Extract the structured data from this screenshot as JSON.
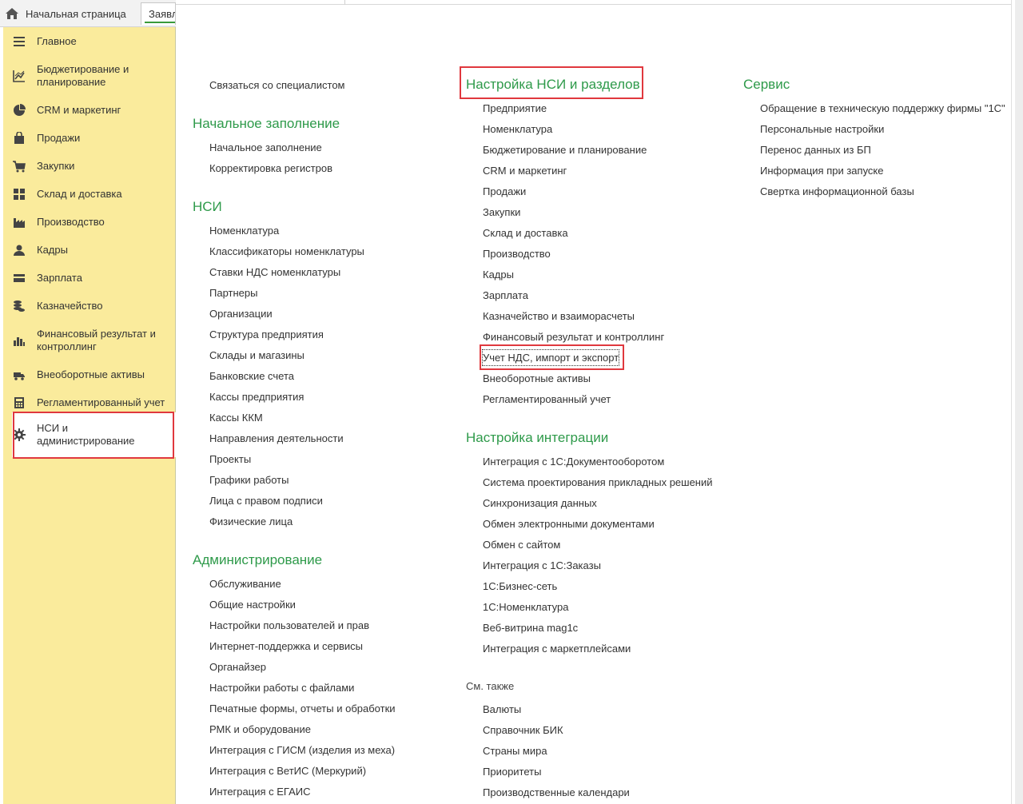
{
  "tabs": {
    "home_label": "Начальная страница",
    "second_label": "Заявления"
  },
  "sidebar": {
    "items": [
      {
        "label": "Главное",
        "icon": "menu-lines-icon"
      },
      {
        "label": "Бюджетирование и планирование",
        "icon": "budget-chart-icon"
      },
      {
        "label": "CRM и маркетинг",
        "icon": "pie-chart-icon"
      },
      {
        "label": "Продажи",
        "icon": "shopping-bag-icon"
      },
      {
        "label": "Закупки",
        "icon": "cart-icon"
      },
      {
        "label": "Склад и доставка",
        "icon": "warehouse-grid-icon"
      },
      {
        "label": "Производство",
        "icon": "factory-icon"
      },
      {
        "label": "Кадры",
        "icon": "person-icon"
      },
      {
        "label": "Зарплата",
        "icon": "wallet-icon"
      },
      {
        "label": "Казначейство",
        "icon": "coins-icon"
      },
      {
        "label": "Финансовый результат и контроллинг",
        "icon": "bar-chart-icon"
      },
      {
        "label": "Внеоборотные активы",
        "icon": "truck-icon"
      },
      {
        "label": "Регламентированный учет",
        "icon": "calculator-icon"
      },
      {
        "label": "НСИ и администрирование",
        "icon": "gear-icon",
        "active": true
      }
    ]
  },
  "col1": {
    "top_link": "Связаться со специалистом",
    "initial": {
      "title": "Начальное заполнение",
      "links": [
        "Начальное заполнение",
        "Корректировка регистров"
      ]
    },
    "nsi": {
      "title": "НСИ",
      "links": [
        "Номенклатура",
        "Классификаторы номенклатуры",
        "Ставки НДС номенклатуры",
        "Партнеры",
        "Организации",
        "Структура предприятия",
        "Склады и магазины",
        "Банковские счета",
        "Кассы предприятия",
        "Кассы ККМ",
        "Направления деятельности",
        "Проекты",
        "Графики работы",
        "Лица с правом подписи",
        "Физические лица"
      ]
    },
    "admin": {
      "title": "Администрирование",
      "links": [
        "Обслуживание",
        "Общие настройки",
        "Настройки пользователей и прав",
        "Интернет-поддержка и сервисы",
        "Органайзер",
        "Настройки работы с файлами",
        "Печатные формы, отчеты и обработки",
        "РМК и оборудование",
        "Интеграция с ГИСМ (изделия из меха)",
        "Интеграция с ВетИС (Меркурий)",
        "Интеграция с ЕГАИС"
      ]
    }
  },
  "col2": {
    "settings": {
      "title": "Настройка НСИ и разделов",
      "links": [
        "Предприятие",
        "Номенклатура",
        "Бюджетирование и планирование",
        "CRM и маркетинг",
        "Продажи",
        "Закупки",
        "Склад и доставка",
        "Производство",
        "Кадры",
        "Зарплата",
        "Казначейство и взаиморасчеты",
        "Финансовый результат и контроллинг",
        "Учет НДС, импорт и экспорт",
        "Внеоборотные активы",
        "Регламентированный учет"
      ]
    },
    "integration": {
      "title": "Настройка интеграции",
      "links": [
        "Интеграция с 1С:Документооборотом",
        "Система проектирования прикладных решений",
        "Синхронизация данных",
        "Обмен электронными документами",
        "Обмен с сайтом",
        "Интеграция с 1С:Заказы",
        "1С:Бизнес-сеть",
        "1С:Номенклатура",
        "Веб-витрина mag1c",
        "Интеграция с маркетплейсами"
      ]
    },
    "see_also": {
      "title": "См. также",
      "links": [
        "Валюты",
        "Справочник БИК",
        "Страны мира",
        "Приоритеты",
        "Производственные календари"
      ]
    }
  },
  "col3": {
    "service": {
      "title": "Сервис",
      "links": [
        "Обращение в техническую поддержку фирмы \"1С\"",
        "Персональные настройки",
        "Перенос данных из БП",
        "Информация при запуске",
        "Свертка информационной базы"
      ]
    }
  },
  "colors": {
    "sidebar_bg": "#faeb9c",
    "section_title": "#2e9a4a",
    "highlight": "#e0383e"
  }
}
